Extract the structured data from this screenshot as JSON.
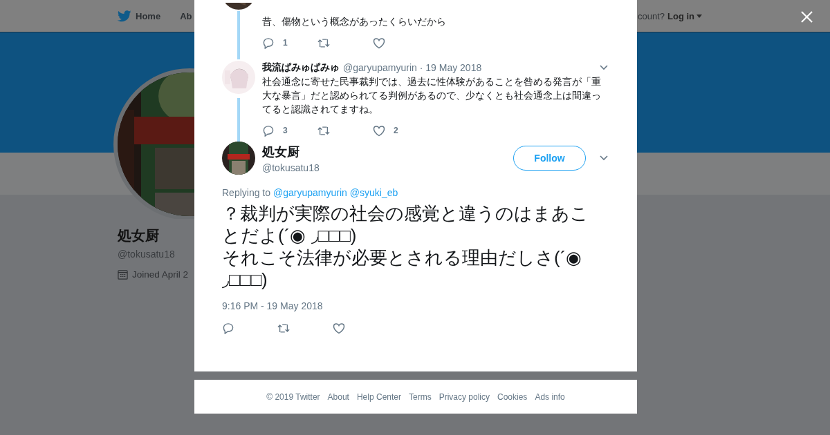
{
  "nav": {
    "items": [
      {
        "label": "Home",
        "kind": "home"
      },
      {
        "label": "Ab",
        "kind": "text"
      }
    ],
    "account_prompt": "count?",
    "login": "Log in"
  },
  "profile": {
    "name": "処女厨",
    "handle": "@tokusatu18",
    "joined": "Joined April 2"
  },
  "thread": [
    {
      "text": "昔、傷物という概念があったくらいだから",
      "replies": "1"
    },
    {
      "name": "我流ぱみゅぱみゅ",
      "handle": "@garyupamyurin",
      "date": "· 19 May 2018",
      "text": "社会通念に寄せた民事裁判では、過去に性体験があることを咎める発言が「重大な暴言」だと認められてる判例があるので、少なくとも社会通念上は間違ってると認識されてますね。",
      "replies": "3",
      "likes": "2"
    }
  ],
  "tweet": {
    "name": "処女厨",
    "handle": "@tokusatu18",
    "follow": "Follow",
    "replying_prefix": "Replying to",
    "mentions": [
      "@garyupamyurin",
      "@syuki_eb"
    ],
    "text": "？裁判が実際の社会の感覚と違うのはまあことだよ(´◉ ◞□□□)\nそれこそ法律が必要とされる理由だしさ(´◉ ◞□□□)",
    "time": "9:16 PM - 19 May 2018"
  },
  "footer": [
    "© 2019 Twitter",
    "About",
    "Help Center",
    "Terms",
    "Privacy policy",
    "Cookies",
    "Ads info"
  ]
}
